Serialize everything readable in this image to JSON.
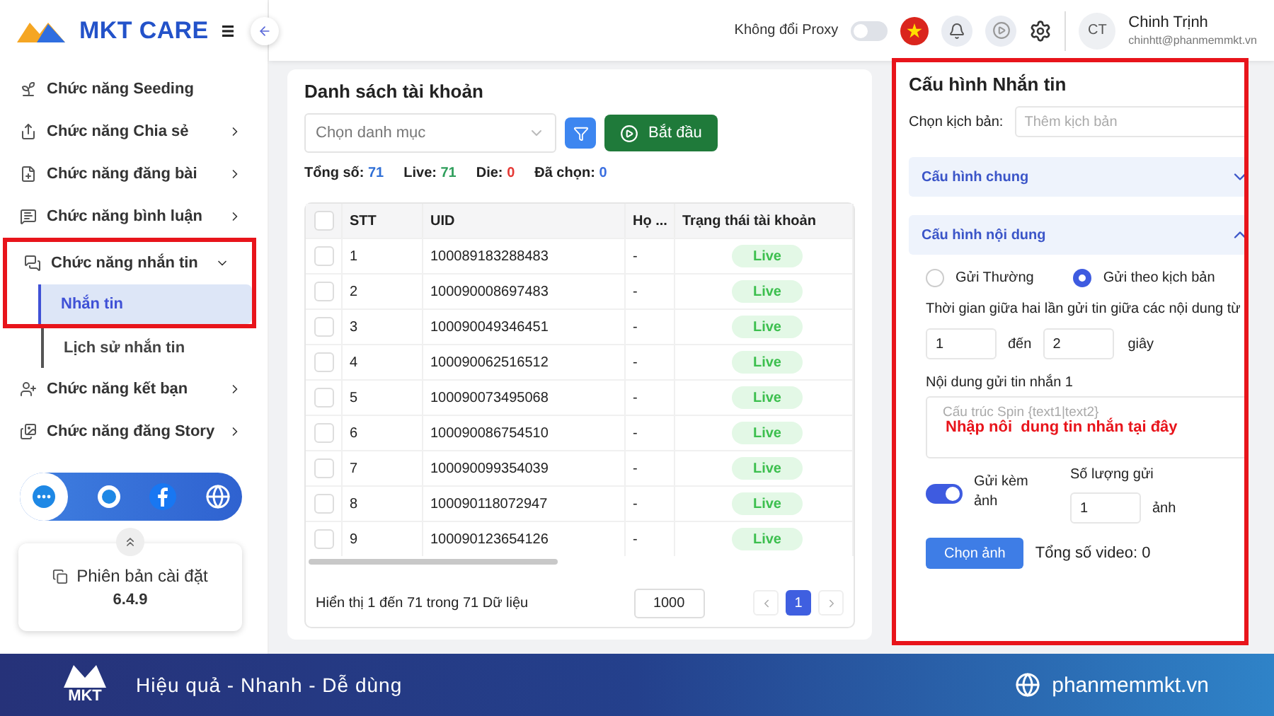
{
  "header": {
    "logo": "MKT CARE",
    "proxy_label": "Không đổi Proxy",
    "proxy_on": false,
    "avatar": "CT",
    "user_name": "Chinh Trịnh",
    "user_email": "chinhtt@phanmemmkt.vn"
  },
  "sidebar": {
    "items": [
      {
        "label": "Chức năng Seeding",
        "kind": "link"
      },
      {
        "label": "Chức năng Chia sẻ",
        "kind": "group",
        "expanded": false
      },
      {
        "label": "Chức năng đăng bài",
        "kind": "group",
        "expanded": false
      },
      {
        "label": "Chức năng bình luận",
        "kind": "group",
        "expanded": false
      },
      {
        "label": "Chức năng nhắn tin",
        "kind": "group",
        "expanded": true,
        "highlight": true,
        "children": [
          {
            "label": "Nhắn tin",
            "selected": true
          },
          {
            "label": "Lịch sử nhắn tin",
            "selected": false
          }
        ]
      },
      {
        "label": "Chức năng kết bạn",
        "kind": "group",
        "expanded": false
      },
      {
        "label": "Chức năng đăng Story",
        "kind": "group",
        "expanded": false
      }
    ],
    "version_label": "Phiên bản cài đặt",
    "version": "6.4.9"
  },
  "accounts": {
    "title": "Danh sách tài khoản",
    "category_placeholder": "Chọn danh mục",
    "start_button": "Bắt đầu",
    "stats": [
      {
        "label": "Tổng số:",
        "value": "71",
        "color": "#2f6fd6"
      },
      {
        "label": "Live:",
        "value": "71",
        "color": "#2e9e5b"
      },
      {
        "label": "Die:",
        "value": "0",
        "color": "#e53935"
      },
      {
        "label": "Đã chọn:",
        "value": "0",
        "color": "#3b6fe0"
      }
    ],
    "all_checked": false,
    "columns": [
      "STT",
      "UID",
      "Họ ...",
      "Trạng thái tài khoản"
    ],
    "rows": [
      {
        "stt": "1",
        "uid": "100089183288483",
        "name": "-",
        "status": "Live",
        "checked": false
      },
      {
        "stt": "2",
        "uid": "100090008697483",
        "name": "-",
        "status": "Live",
        "checked": false
      },
      {
        "stt": "3",
        "uid": "100090049346451",
        "name": "-",
        "status": "Live",
        "checked": false
      },
      {
        "stt": "4",
        "uid": "100090062516512",
        "name": "-",
        "status": "Live",
        "checked": false
      },
      {
        "stt": "5",
        "uid": "100090073495068",
        "name": "-",
        "status": "Live",
        "checked": false
      },
      {
        "stt": "6",
        "uid": "100090086754510",
        "name": "-",
        "status": "Live",
        "checked": false
      },
      {
        "stt": "7",
        "uid": "100090099354039",
        "name": "-",
        "status": "Live",
        "checked": false
      },
      {
        "stt": "8",
        "uid": "100090118072947",
        "name": "-",
        "status": "Live",
        "checked": false
      },
      {
        "stt": "9",
        "uid": "100090123654126",
        "name": "-",
        "status": "Live",
        "checked": false
      }
    ],
    "footer_text": "Hiển thị 1 đến 71 trong 71 Dữ liệu",
    "page_size": "1000",
    "pages": [
      {
        "label": "1",
        "selected": true
      }
    ]
  },
  "config": {
    "title": "Cấu hình Nhắn tin",
    "highlight": true,
    "script_label": "Chọn kịch bản:",
    "script_placeholder": "Thêm kịch bản",
    "sections": [
      {
        "title": "Cấu hình chung",
        "expanded": false
      },
      {
        "title": "Cấu hình nội dung",
        "expanded": true
      }
    ],
    "modes": [
      {
        "label": "Gửi Thường",
        "selected": false
      },
      {
        "label": "Gửi theo kịch bản",
        "selected": true
      }
    ],
    "interval_label": "Thời gian giữa hai lần gửi tin giữa các nội dung từ",
    "interval_from": "1",
    "interval_between": "đến",
    "interval_to": "2",
    "interval_unit": "giây",
    "message_label": "Nội dung gửi tin nhắn 1",
    "message_placeholder": "Cấu trúc Spin {text1|text2}",
    "message_note": "Nhập nôi  dung tin nhắn tại đây",
    "attach_label": "Gửi kèm ảnh",
    "attach_on": true,
    "count_label": "Số lượng gửi",
    "count_value": "1",
    "count_unit": "ảnh",
    "choose_button": "Chọn ảnh",
    "video_total": "Tổng số video: 0"
  },
  "banner": {
    "logo": "MKT",
    "slogan": "Hiệu quả - Nhanh - Dễ dùng",
    "site": "phanmemmkt.vn"
  }
}
